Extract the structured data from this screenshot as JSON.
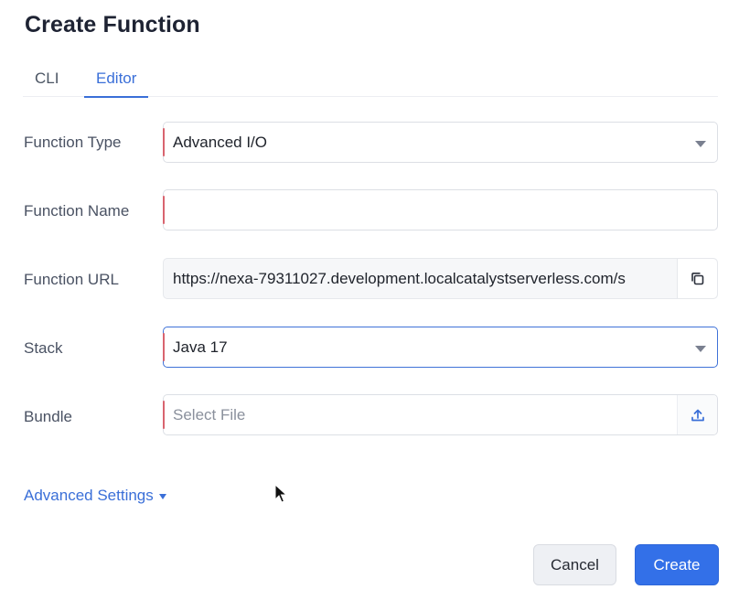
{
  "dialog": {
    "title": "Create Function",
    "tabs": [
      {
        "label": "CLI",
        "active": false
      },
      {
        "label": "Editor",
        "active": true
      }
    ]
  },
  "form": {
    "function_type": {
      "label": "Function Type",
      "value": "Advanced I/O"
    },
    "function_name": {
      "label": "Function Name",
      "value": "",
      "placeholder": ""
    },
    "function_url": {
      "label": "Function URL",
      "value": "https://nexa-79311027.development.localcatalystserverless.com/s"
    },
    "stack": {
      "label": "Stack",
      "value": "Java 17"
    },
    "bundle": {
      "label": "Bundle",
      "placeholder": "Select File"
    }
  },
  "advanced_settings": {
    "label": "Advanced Settings"
  },
  "buttons": {
    "cancel": "Cancel",
    "create": "Create"
  },
  "colors": {
    "accent": "#3370e8",
    "required_marker": "#d9646f",
    "link": "#3a6fd8"
  },
  "icons": [
    "chevron-down-icon",
    "copy-icon",
    "upload-icon",
    "mouse-pointer-icon"
  ]
}
